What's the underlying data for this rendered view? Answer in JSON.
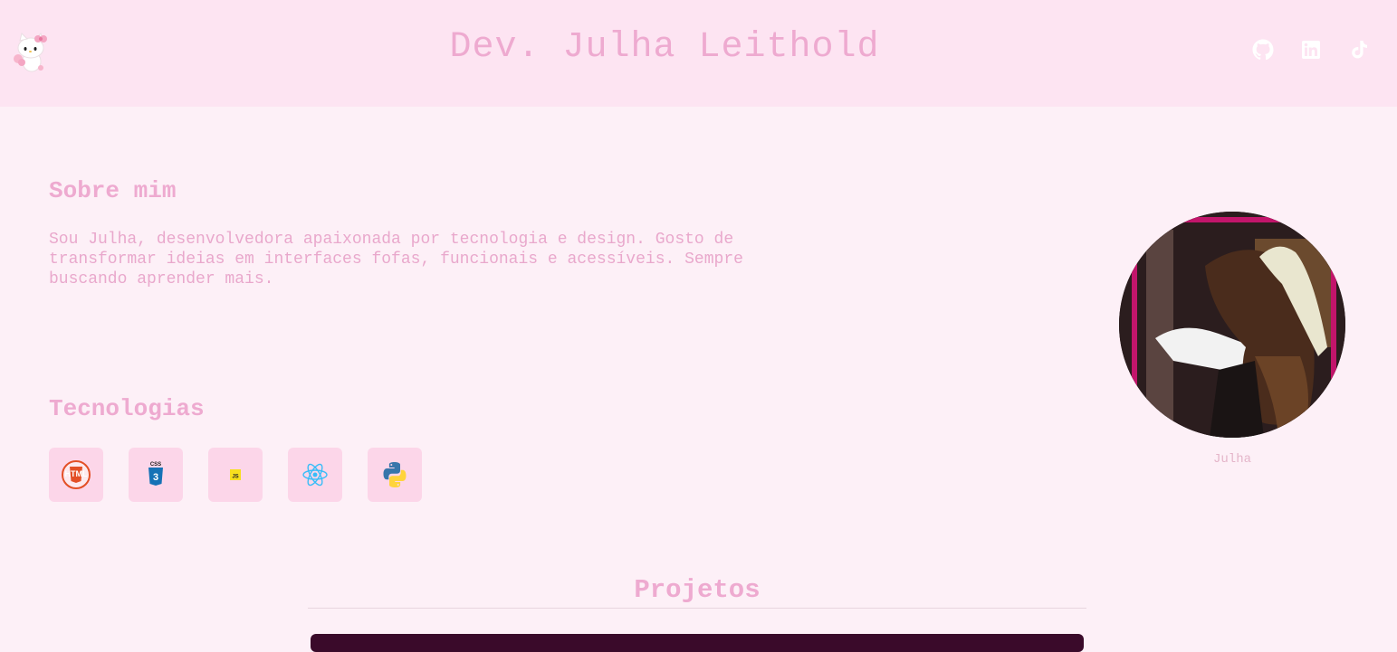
{
  "header": {
    "title": "Dev. Julha Leithold",
    "logo_icon": "hello-kitty-icon",
    "socials": [
      {
        "name": "github",
        "icon": "github-icon"
      },
      {
        "name": "linkedin",
        "icon": "linkedin-icon"
      },
      {
        "name": "tiktok",
        "icon": "tiktok-icon"
      }
    ]
  },
  "about": {
    "heading": "Sobre mim",
    "text": "Sou Julha, desenvolvedora apaixonada por tecnologia e design. Gosto de transformar ideias em interfaces fofas, funcionais e acessíveis. Sempre buscando aprender mais."
  },
  "technologies": {
    "heading": "Tecnologias",
    "items": [
      {
        "icon": "html5-icon",
        "label": "HTML"
      },
      {
        "icon": "css3-icon",
        "label": "CSS"
      },
      {
        "icon": "javascript-icon",
        "label": "JS"
      },
      {
        "icon": "react-icon"
      },
      {
        "icon": "python-icon"
      }
    ]
  },
  "profile": {
    "caption": "Julha"
  },
  "projects": {
    "heading": "Projetos"
  },
  "colors": {
    "background": "#fdf0f7",
    "header_background": "#fde4f2",
    "accent_pink": "#eeaad0",
    "tech_tile": "#fcd6e9"
  }
}
